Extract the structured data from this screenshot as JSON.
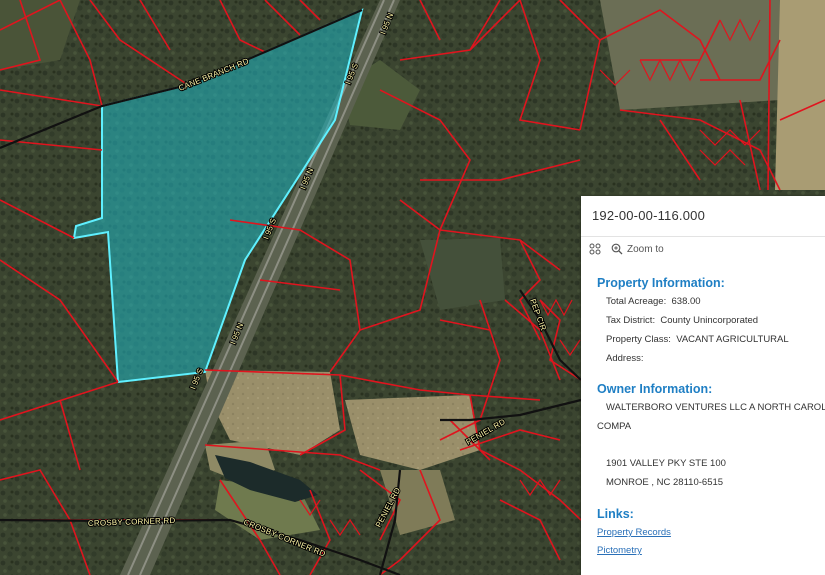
{
  "map": {
    "road_labels": {
      "cane_branch": "CANE BRANCH RD",
      "i95n_top": "I 95 N",
      "i95s_top": "I 95 S",
      "i95n_mid": "I 95 N",
      "i95s_mid": "I 95 S",
      "i95n_low": "I 95 N",
      "i95s_low": "I 95 S",
      "peniel_rd": "PENIEL RD",
      "peniel_rd_2": "PENIEL RD",
      "crosby_corner_1": "CROSBY CORNER RD",
      "crosby_corner_2": "CROSBY CORNER RD",
      "pep_cir": "PEP CIR"
    },
    "colors": {
      "parcel_line": "#e0141e",
      "selected_parcel_fill": "#1fb8c4",
      "selected_parcel_outline": "#5ff0ff",
      "road_label": "#fff7a8"
    }
  },
  "popup": {
    "title": "192-00-00-116.000",
    "actions": {
      "zoom_label": "Zoom to",
      "menu_icon": "grid-icon",
      "zoom_icon": "zoom-in-icon"
    },
    "property_info": {
      "heading": "Property Information:",
      "acreage_label": "Total Acreage:",
      "acreage_value": "638.00",
      "tax_label": "Tax District:",
      "tax_value": "County Unincorporated",
      "class_label": "Property Class:",
      "class_value": "VACANT AGRICULTURAL",
      "address_label": "Address:"
    },
    "owner_info": {
      "heading": "Owner Information:",
      "owner_line1": "WALTERBORO VENTURES LLC A NORTH CAROLINA",
      "owner_line2": "COMPA",
      "addr_line1": "1901 VALLEY PKY STE 100",
      "addr_line2": "MONROE , NC  28110-6515"
    },
    "links": {
      "heading": "Links:",
      "property_records": "Property Records",
      "pictometry": "Pictometry"
    }
  }
}
